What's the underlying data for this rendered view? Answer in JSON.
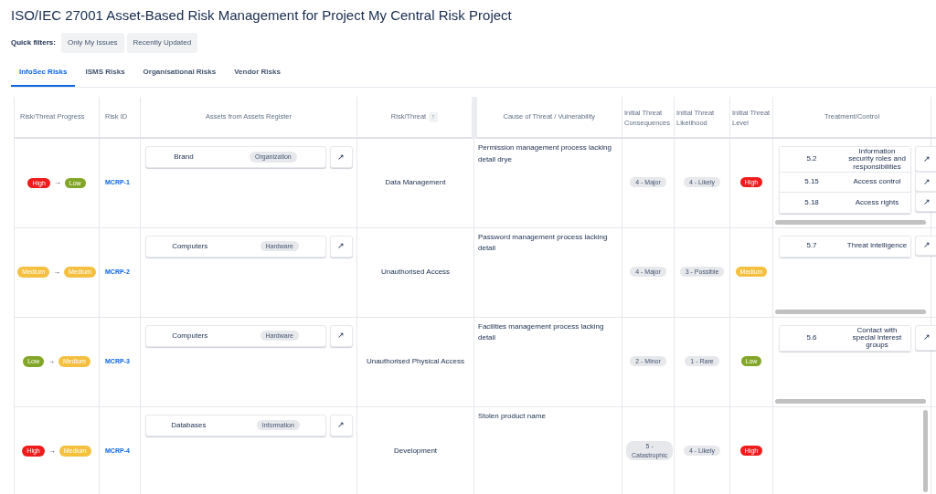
{
  "title": "ISO/IEC 27001 Asset-Based Risk Management for Project My Central Risk Project",
  "quick_filters": {
    "label": "Quick filters:",
    "buttons": [
      "Only My Issues",
      "Recently Updated"
    ]
  },
  "tabs": [
    {
      "label": "InfoSec Risks",
      "selected": true
    },
    {
      "label": "ISMS Risks",
      "selected": false
    },
    {
      "label": "Organisational Risks",
      "selected": false
    },
    {
      "label": "Vendor Risks",
      "selected": false
    }
  ],
  "table": {
    "columns": [
      "Risk/Threat Progress",
      "Risk ID",
      "Assets from Assets Register",
      "Risk/Threat",
      "Cause of Threat / Vulnerability",
      "Initial Threat Consequences",
      "Initial Threat Likelihood",
      "Initial Threat Level",
      "Treatment/Control"
    ],
    "sort_arrow": "↑",
    "rows": [
      {
        "progress_from": {
          "text": "High",
          "color": "#ef1c1c"
        },
        "arrow": "→",
        "progress_to": {
          "text": "Low",
          "color": "#82a627"
        },
        "risk_id": "MCRP-1",
        "asset": {
          "name": "Brand",
          "type": "Organization",
          "open": "↗"
        },
        "risk": "Data Management",
        "cause": "Permission management process lacking detail drye",
        "consequences": "4 - Major",
        "likelihood": "4 - Likely",
        "level": {
          "text": "High",
          "color": "#ef1c1c"
        },
        "controls": [
          {
            "code": "5.2",
            "name": "Information security roles and responsibilities",
            "open": "↗"
          },
          {
            "code": "5.15",
            "name": "Access control",
            "open": "↗"
          },
          {
            "code": "5.18",
            "name": "Access rights",
            "open": "↗"
          }
        ]
      },
      {
        "progress_from": {
          "text": "Medium",
          "color": "#f5c03f"
        },
        "arrow": "→",
        "progress_to": {
          "text": "Medium",
          "color": "#f5c03f"
        },
        "risk_id": "MCRP-2",
        "asset": {
          "name": "Computers",
          "type": "Hardware",
          "open": "↗"
        },
        "risk": "Unauthorised Access",
        "cause": "Password management process lacking detail",
        "consequences": "4 - Major",
        "likelihood": "3 - Possible",
        "level": {
          "text": "Medium",
          "color": "#f5c03f"
        },
        "controls": [
          {
            "code": "5.7",
            "name": "Threat intelligence",
            "open": "↗"
          }
        ]
      },
      {
        "progress_from": {
          "text": "Low",
          "color": "#82a627"
        },
        "arrow": "→",
        "progress_to": {
          "text": "Medium",
          "color": "#f5c03f"
        },
        "risk_id": "MCRP-3",
        "asset": {
          "name": "Computers",
          "type": "Hardware",
          "open": "↗"
        },
        "risk": "Unauthorised Physical Access",
        "cause": "Facilities management process lacking detail",
        "consequences": "2 - Minor",
        "likelihood": "1 - Rare",
        "level": {
          "text": "Low",
          "color": "#82a627"
        },
        "controls": [
          {
            "code": "5.6",
            "name": "Contact with special interest groups",
            "open": "↗"
          }
        ]
      },
      {
        "progress_from": {
          "text": "High",
          "color": "#ef1c1c"
        },
        "arrow": "→",
        "progress_to": {
          "text": "Medium",
          "color": "#f5c03f"
        },
        "risk_id": "MCRP-4",
        "asset": {
          "name": "Databases",
          "type": "Information",
          "open": "↗"
        },
        "risk": "Development",
        "cause": "Stolen product name",
        "consequences": "5 - Catastrophic",
        "likelihood": "4 - Likely",
        "level": {
          "text": "High",
          "color": "#ef1c1c"
        }
      }
    ]
  }
}
